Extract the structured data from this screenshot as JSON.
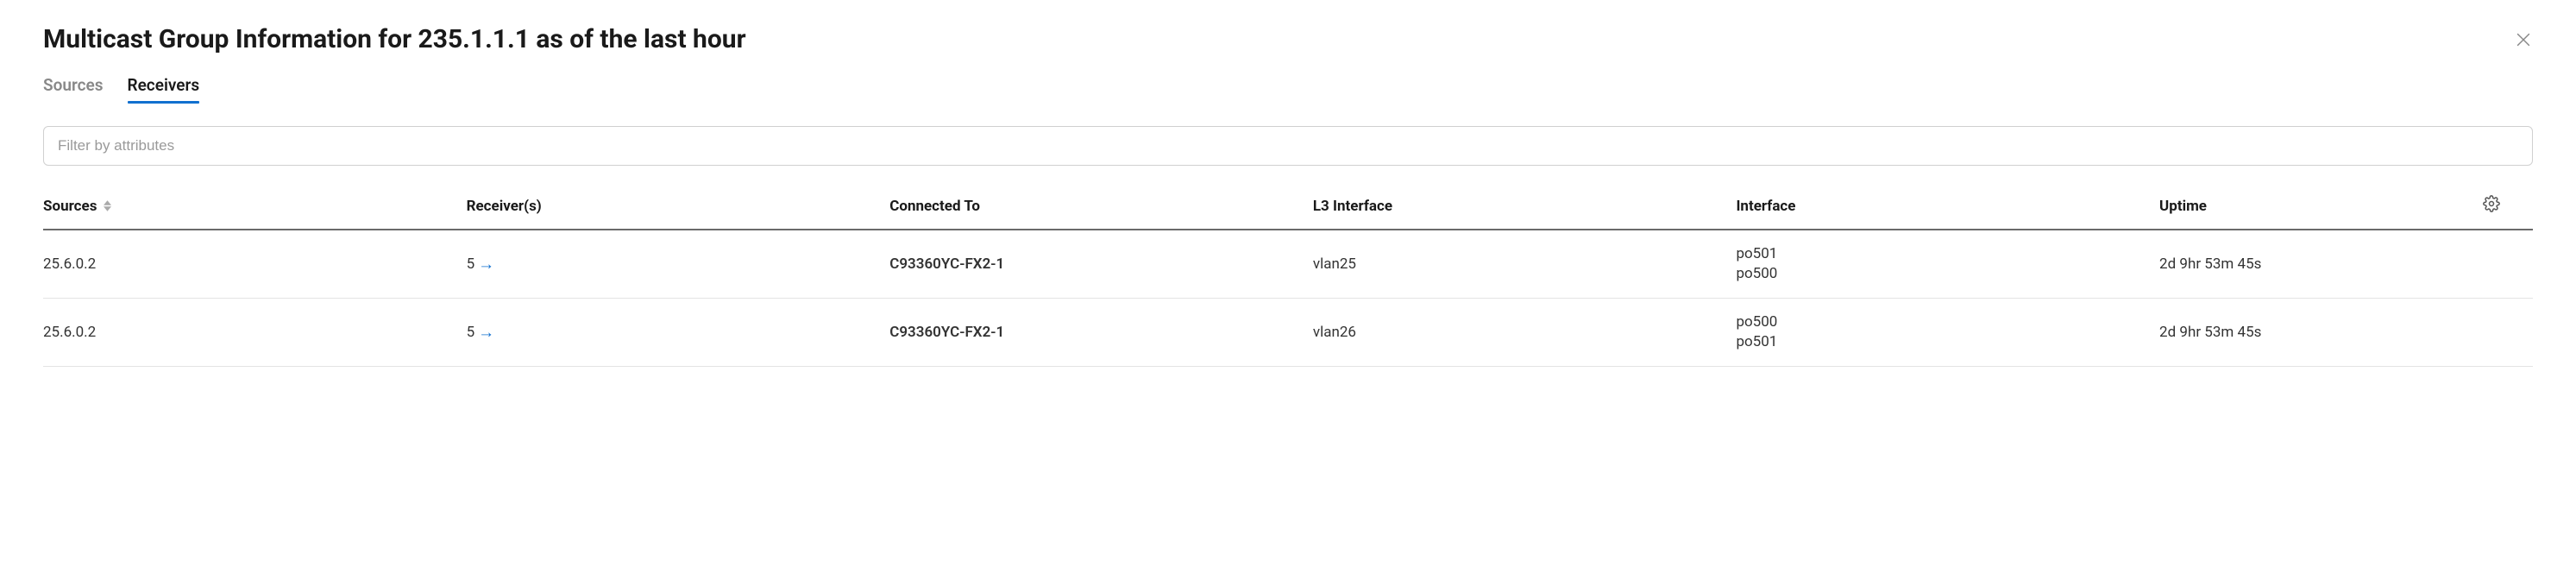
{
  "header": {
    "title": "Multicast Group Information for 235.1.1.1 as of the last hour"
  },
  "tabs": [
    {
      "label": "Sources",
      "active": false
    },
    {
      "label": "Receivers",
      "active": true
    }
  ],
  "filter": {
    "placeholder": "Filter by attributes"
  },
  "columns": {
    "sources": "Sources",
    "receivers": "Receiver(s)",
    "connected_to": "Connected To",
    "l3_interface": "L3 Interface",
    "interface": "Interface",
    "uptime": "Uptime"
  },
  "rows": [
    {
      "source": "25.6.0.2",
      "receivers": "5",
      "connected_to": "C93360YC-FX2-1",
      "l3_interface": "vlan25",
      "interfaces": [
        "po501",
        "po500"
      ],
      "uptime": "2d 9hr 53m 45s"
    },
    {
      "source": "25.6.0.2",
      "receivers": "5",
      "connected_to": "C93360YC-FX2-1",
      "l3_interface": "vlan26",
      "interfaces": [
        "po500",
        "po501"
      ],
      "uptime": "2d 9hr 53m 45s"
    }
  ]
}
